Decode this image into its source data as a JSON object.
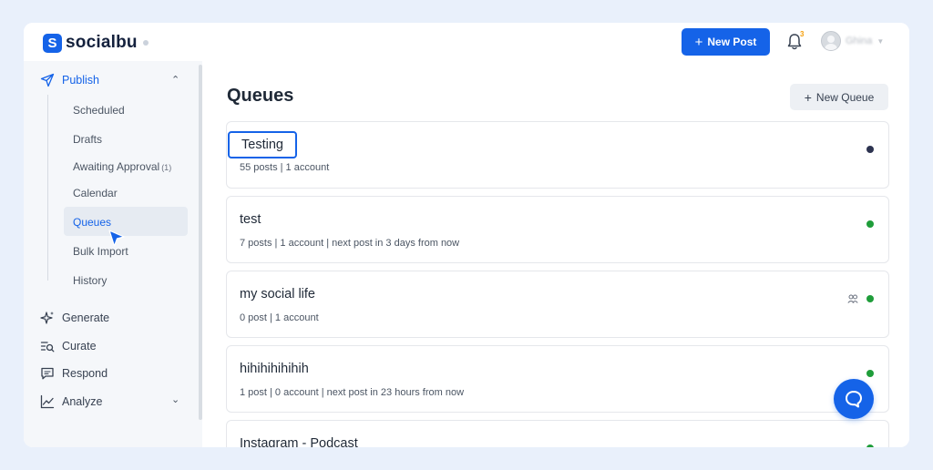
{
  "brand": {
    "name": "socialbu"
  },
  "header": {
    "new_post_label": "New Post",
    "notification_count": "3",
    "user_name": "Ghina"
  },
  "sidebar": {
    "sections": [
      {
        "label": "Publish",
        "icon": "send-icon",
        "expanded": true
      },
      {
        "label": "Generate",
        "icon": "sparkles-icon"
      },
      {
        "label": "Curate",
        "icon": "curate-search-icon"
      },
      {
        "label": "Respond",
        "icon": "chat-icon"
      },
      {
        "label": "Analyze",
        "icon": "chart-line-icon",
        "expandable": true
      }
    ],
    "publish_items": [
      {
        "label": "Scheduled"
      },
      {
        "label": "Drafts"
      },
      {
        "label": "Awaiting Approval",
        "count": "(1)"
      },
      {
        "label": "Calendar"
      },
      {
        "label": "Queues",
        "active": true
      },
      {
        "label": "Bulk Import"
      },
      {
        "label": "History"
      }
    ]
  },
  "main": {
    "title": "Queues",
    "new_queue_label": "New Queue",
    "queues": [
      {
        "name": "Testing",
        "meta": "55 posts | 1 account",
        "status_color": "#2d3350",
        "highlighted": true
      },
      {
        "name": "test",
        "meta": "7 posts | 1 account | next post in 3 days from now",
        "status_color": "#1f9d3a"
      },
      {
        "name": "my social life",
        "meta": "0 post | 1 account",
        "status_color": "#1f9d3a",
        "shared": true
      },
      {
        "name": "hihihihihihih",
        "meta": "1 post | 0 account | next post in 23 hours from now",
        "status_color": "#1f9d3a"
      },
      {
        "name": "Instagram - Podcast",
        "meta": "",
        "status_color": "#1f9d3a"
      }
    ]
  },
  "colors": {
    "accent": "#1563e8",
    "sidebar_bg": "#f5f7fa",
    "page_bg": "#e9f0fb"
  }
}
